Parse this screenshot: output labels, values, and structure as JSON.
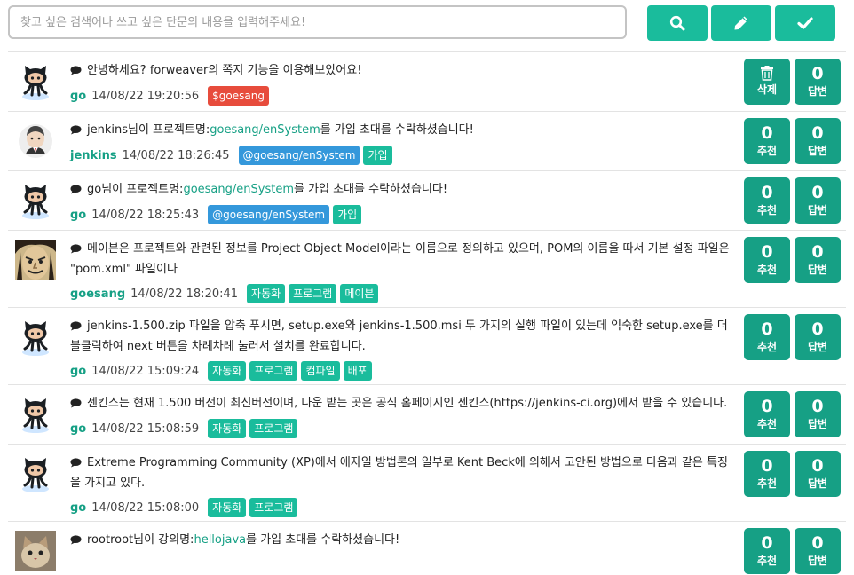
{
  "search": {
    "placeholder": "찾고 싶은 검색어나 쓰고 싶은 단문의 내용을 입력해주세요!"
  },
  "toolbar": {
    "search_icon": "search-icon",
    "write_icon": "pencil-icon",
    "submit_icon": "check-icon"
  },
  "colors": {
    "accent": "#1abc9c",
    "accent_dark": "#16a085",
    "red": "#e74c3c",
    "blue": "#3498db"
  },
  "items": [
    {
      "avatar": "octocat",
      "text": [
        {
          "t": "안녕하세요? forweaver의 쪽지 기능을 이용해보았어요!"
        }
      ],
      "user": "go",
      "date": "14/08/22 19:20:56",
      "tags": [
        {
          "label": "$goesang",
          "color": "red"
        }
      ],
      "left_action": {
        "kind": "delete",
        "label": "삭제"
      },
      "reply": {
        "count": "0",
        "label": "답변"
      }
    },
    {
      "avatar": "jenkins",
      "text": [
        {
          "t": "jenkins님이 프로젝트명:"
        },
        {
          "t": "goesang/enSystem",
          "link": true
        },
        {
          "t": "를 가입 초대를 수락하셨습니다!"
        }
      ],
      "user": "jenkins",
      "date": "14/08/22 18:26:45",
      "tags": [
        {
          "label": "@goesang/enSystem",
          "color": "blue"
        },
        {
          "label": "가입",
          "color": "green"
        }
      ],
      "left_action": {
        "kind": "recommend",
        "count": "0",
        "label": "추천"
      },
      "reply": {
        "count": "0",
        "label": "답변"
      }
    },
    {
      "avatar": "octocat",
      "text": [
        {
          "t": "go님이 프로젝트명:"
        },
        {
          "t": "goesang/enSystem",
          "link": true
        },
        {
          "t": "를 가입 초대를 수락하셨습니다!"
        }
      ],
      "user": "go",
      "date": "14/08/22 18:25:43",
      "tags": [
        {
          "label": "@goesang/enSystem",
          "color": "blue"
        },
        {
          "label": "가입",
          "color": "green"
        }
      ],
      "left_action": {
        "kind": "recommend",
        "count": "0",
        "label": "추천"
      },
      "reply": {
        "count": "0",
        "label": "답변"
      }
    },
    {
      "avatar": "cartoon",
      "text": [
        {
          "t": "메이븐은 프로젝트와 관련된 정보를 Project Object Model이라는 이름으로 정의하고 있으며, POM의 이름을 따서 기본 설정 파일은 \"pom.xml\" 파일이다"
        }
      ],
      "user": "goesang",
      "date": "14/08/22 18:20:41",
      "tags": [
        {
          "label": "자동화",
          "color": "green"
        },
        {
          "label": "프로그램",
          "color": "green"
        },
        {
          "label": "메이븐",
          "color": "green"
        }
      ],
      "left_action": {
        "kind": "recommend",
        "count": "0",
        "label": "추천"
      },
      "reply": {
        "count": "0",
        "label": "답변"
      }
    },
    {
      "avatar": "octocat",
      "text": [
        {
          "t": "jenkins-1.500.zip 파일을 압축 푸시면, setup.exe와 jenkins-1.500.msi 두 가지의 실행 파일이 있는데 익숙한 setup.exe를 더블클릭하여 next 버튼을 차례차례 눌러서 설치를 완료합니다."
        }
      ],
      "user": "go",
      "date": "14/08/22 15:09:24",
      "tags": [
        {
          "label": "자동화",
          "color": "green"
        },
        {
          "label": "프로그램",
          "color": "green"
        },
        {
          "label": "컴파일",
          "color": "green"
        },
        {
          "label": "배포",
          "color": "green"
        }
      ],
      "left_action": {
        "kind": "recommend",
        "count": "0",
        "label": "추천"
      },
      "reply": {
        "count": "0",
        "label": "답변"
      }
    },
    {
      "avatar": "octocat",
      "text": [
        {
          "t": "젠킨스는 현재 1.500 버전이 최신버전이며, 다운 받는 곳은 공식 홈페이지인 젠킨스(https://jenkins-ci.org)에서 받을 수 있습니다."
        }
      ],
      "user": "go",
      "date": "14/08/22 15:08:59",
      "tags": [
        {
          "label": "자동화",
          "color": "green"
        },
        {
          "label": "프로그램",
          "color": "green"
        }
      ],
      "left_action": {
        "kind": "recommend",
        "count": "0",
        "label": "추천"
      },
      "reply": {
        "count": "0",
        "label": "답변"
      }
    },
    {
      "avatar": "octocat",
      "text": [
        {
          "t": "Extreme Programming Community (XP)에서 애자일 방법론의 일부로 Kent Beck에 의해서 고안된 방법으로 다음과 같은 특징을 가지고 있다."
        }
      ],
      "user": "go",
      "date": "14/08/22 15:08:00",
      "tags": [
        {
          "label": "자동화",
          "color": "green"
        },
        {
          "label": "프로그램",
          "color": "green"
        }
      ],
      "left_action": {
        "kind": "recommend",
        "count": "0",
        "label": "추천"
      },
      "reply": {
        "count": "0",
        "label": "답변"
      }
    },
    {
      "avatar": "cat",
      "text": [
        {
          "t": "rootroot님이 강의명:"
        },
        {
          "t": "hellojava",
          "link": true
        },
        {
          "t": "를 가입 초대를 수락하셨습니다!"
        }
      ],
      "user": "",
      "date": "",
      "tags": [],
      "left_action": {
        "kind": "recommend",
        "count": "0",
        "label": "추천"
      },
      "reply": {
        "count": "0",
        "label": "답변"
      }
    }
  ]
}
